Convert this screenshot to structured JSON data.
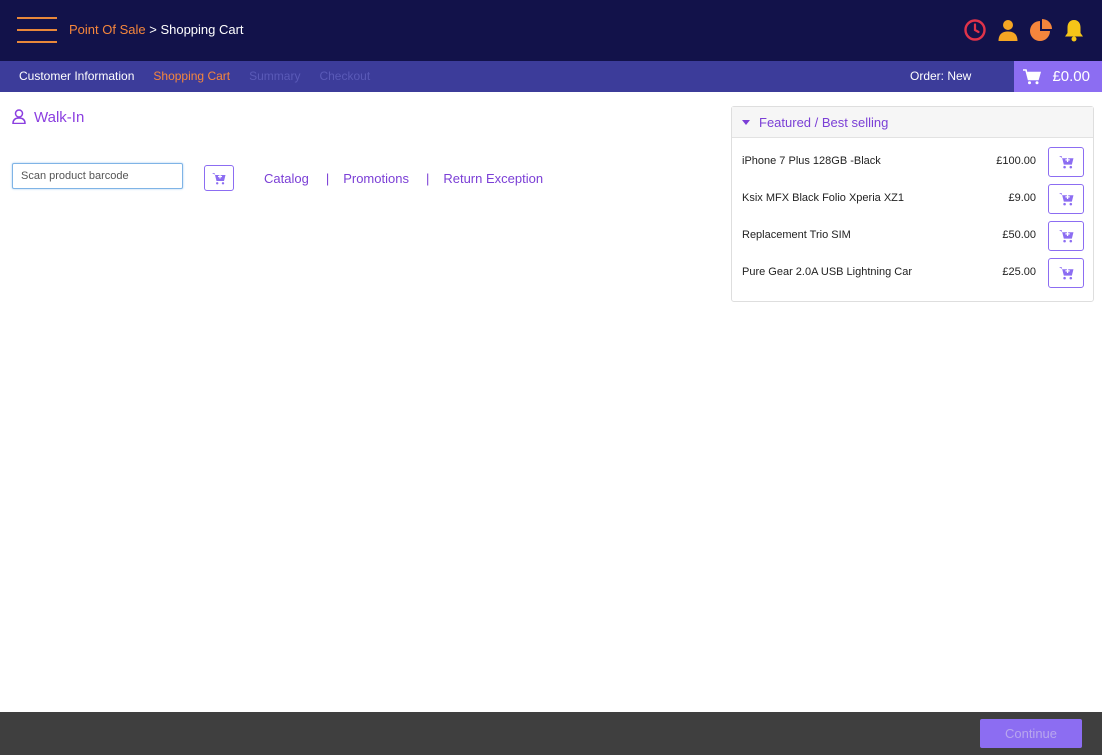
{
  "header": {
    "breadcrumb_root": "Point Of Sale",
    "breadcrumb_separator": " > ",
    "breadcrumb_current": "Shopping Cart",
    "icons": [
      "clock-icon",
      "user-icon",
      "pie-chart-icon",
      "bell-icon"
    ],
    "colors": {
      "background": "#12124a",
      "accent": "#f5863c",
      "clock": "#e0334a",
      "user": "#f5a623",
      "chart": "#f5863c",
      "bell": "#f5c518"
    }
  },
  "steps": [
    {
      "label": "Customer Information",
      "state": "done"
    },
    {
      "label": "Shopping Cart",
      "state": "active"
    },
    {
      "label": "Summary",
      "state": "disabled"
    },
    {
      "label": "Checkout",
      "state": "disabled"
    }
  ],
  "order": {
    "label": "Order: New",
    "cart_total": "£0.00"
  },
  "customer": {
    "name": "Walk-In"
  },
  "scan": {
    "placeholder": "Scan product barcode"
  },
  "links": {
    "catalog": "Catalog",
    "promotions": "Promotions",
    "return_exception": "Return Exception",
    "separator": "|"
  },
  "featured": {
    "title": "Featured / Best selling",
    "products": [
      {
        "name": "iPhone 7 Plus 128GB -Black",
        "price": "£100.00"
      },
      {
        "name": "Ksix MFX Black Folio Xperia XZ1",
        "price": "£9.00"
      },
      {
        "name": "Replacement Trio SIM",
        "price": "£50.00"
      },
      {
        "name": "Pure Gear 2.0A USB Lightning Car",
        "price": "£25.00"
      }
    ]
  },
  "footer": {
    "continue_label": "Continue"
  },
  "theme": {
    "primary": "#8c6df2",
    "link": "#7b3fd6",
    "nav": "#3c3c9a",
    "footer": "#3f3f3f"
  }
}
